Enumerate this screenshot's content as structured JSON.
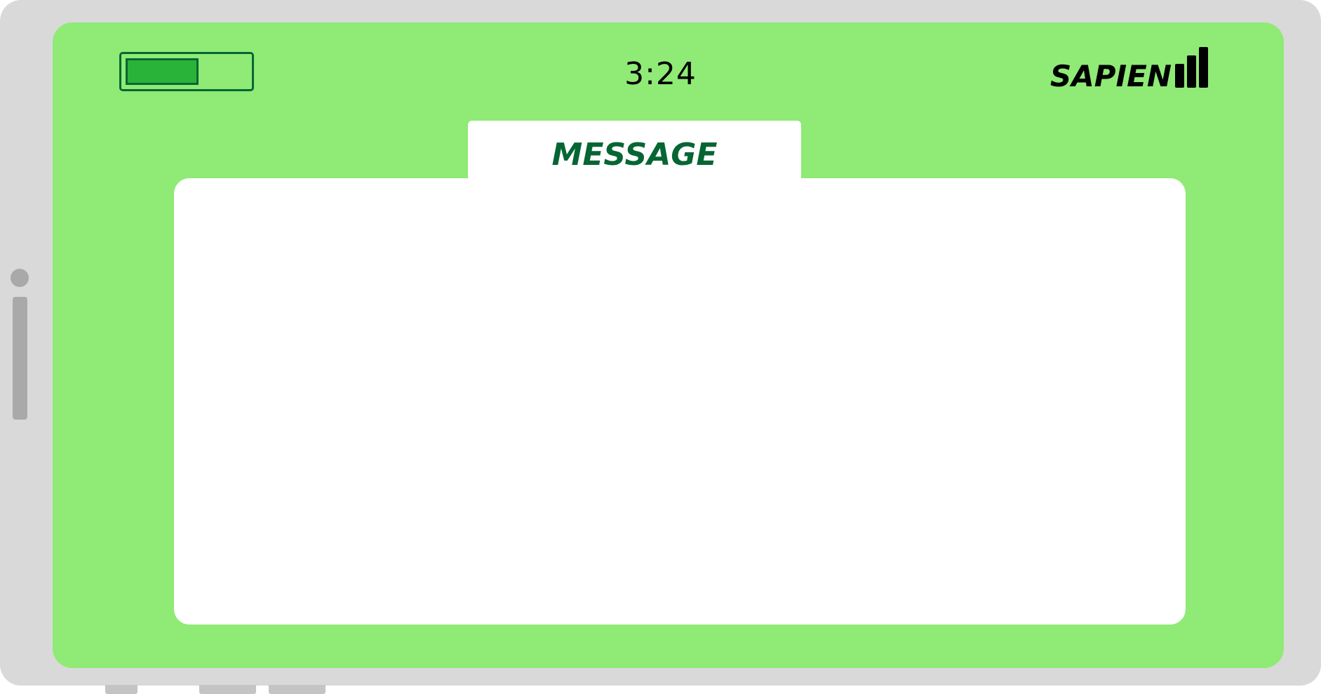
{
  "status_bar": {
    "battery_level": 0.6,
    "time": "3:24",
    "carrier": "SAPIEN",
    "signal_bars": 3
  },
  "message": {
    "title": "MESSAGE",
    "body": ""
  },
  "colors": {
    "frame": "#d9d9d9",
    "screen": "#8fea76",
    "accent_dark": "#066633",
    "battery_fill": "#2ab339",
    "panel": "#ffffff"
  }
}
